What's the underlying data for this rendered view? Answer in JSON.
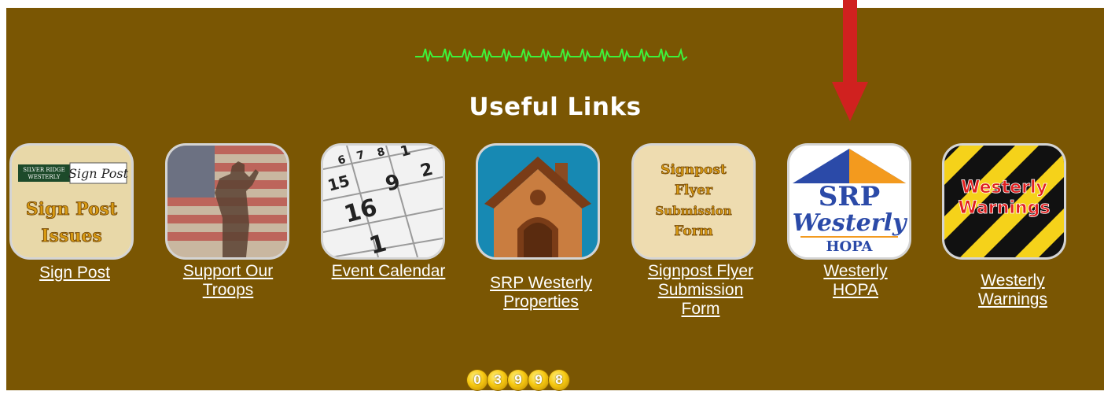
{
  "section": {
    "title": "Useful Links"
  },
  "links": [
    {
      "label_lines": [
        "Sign Post"
      ],
      "icon": "sign-post-icon"
    },
    {
      "label_lines": [
        "Support Our",
        "Troops"
      ],
      "icon": "saluting-soldier-flag-icon"
    },
    {
      "label_lines": [
        "Event Calendar"
      ],
      "icon": "calendar-icon"
    },
    {
      "label_lines": [
        "SRP Westerly",
        "Properties"
      ],
      "icon": "house-icon"
    },
    {
      "label_lines": [
        "Signpost Flyer",
        "Submission",
        "Form"
      ],
      "icon": "flyer-form-icon"
    },
    {
      "label_lines": [
        "Westerly",
        "HOPA"
      ],
      "icon": "srp-westerly-hopa-logo"
    },
    {
      "label_lines": [
        "Westerly",
        "Warnings"
      ],
      "icon": "westerly-warnings-icon"
    }
  ],
  "tiles_text": {
    "signpost_brand_1": "SILVER RIDGE",
    "signpost_brand_2": "WESTERLY",
    "signpost_tag": "Sign Post",
    "signpost_big_1": "Sign Post",
    "signpost_big_2": "Issues",
    "flyer_1": "Signpost",
    "flyer_2": "Flyer",
    "flyer_3": "Submission",
    "flyer_4": "Form",
    "hopa_1": "SRP",
    "hopa_2": "Westerly",
    "hopa_3": "HOPA",
    "warn_1": "Westerly",
    "warn_2": "Warnings",
    "cal_numbers": [
      "6",
      "7",
      "8",
      "1",
      "2",
      "15",
      "9",
      "16",
      "1"
    ]
  },
  "visitor_counter": {
    "digits": [
      "0",
      "3",
      "9",
      "9",
      "8"
    ]
  },
  "colors": {
    "background": "#7a5603",
    "heartbeat": "#3ef23a",
    "arrow": "#d0211f",
    "counter_gold": "#f7c912"
  }
}
